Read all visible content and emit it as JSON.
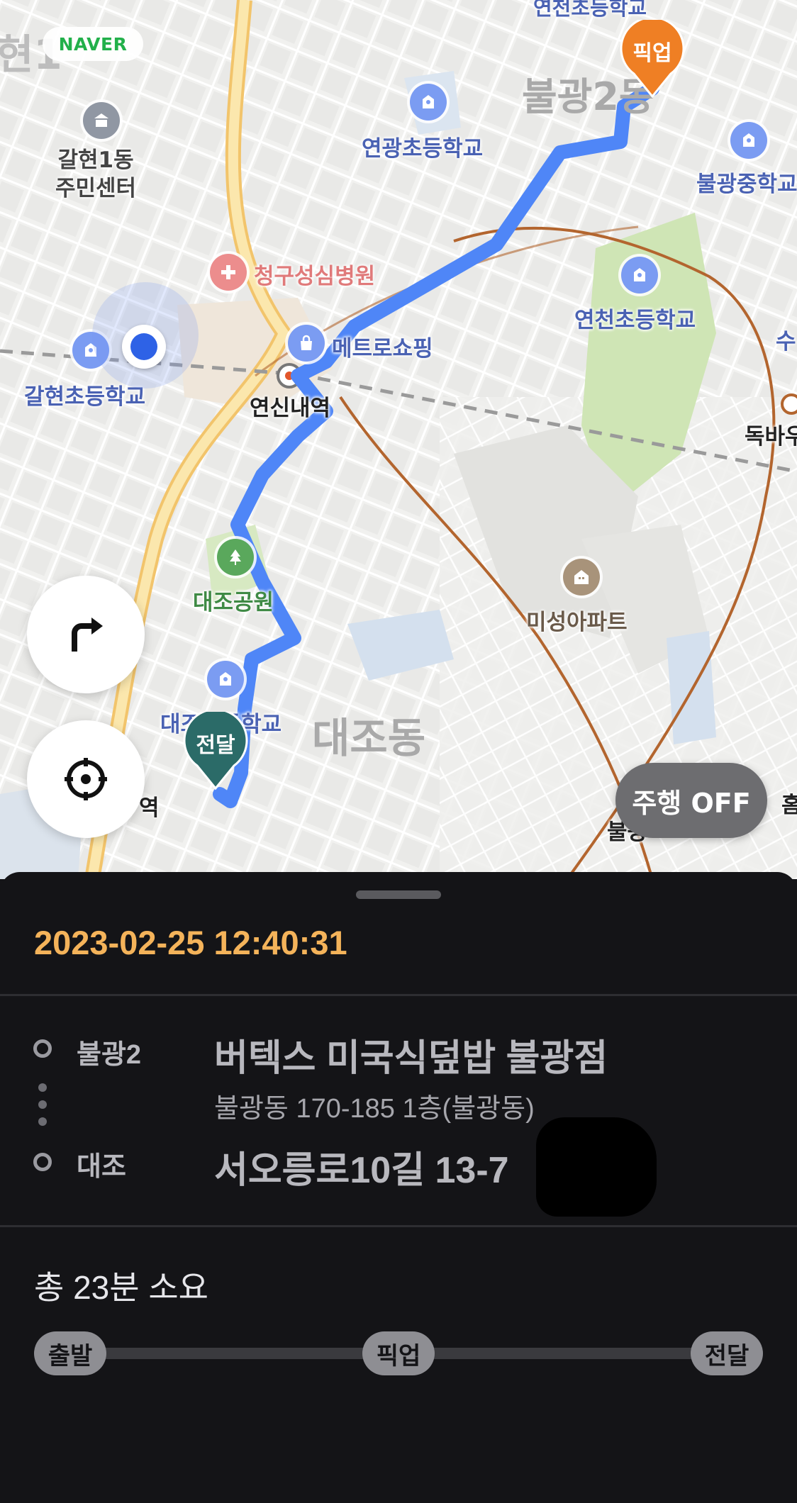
{
  "map": {
    "provider_badge": "NAVER",
    "labels": {
      "galhyeon1_center": "갈현1동\n주민센터",
      "yeongwang_school": "연광초등학교",
      "bulgwang_middle": "불광중학교",
      "cheonggu_hospital": "청구성심병원",
      "yeoncheon_school": "연천초등학교",
      "metro_shopping": "메트로쇼핑",
      "galhyeon_school": "갈현초등학교",
      "yeonsinnae_station": "연신내역",
      "dokbawi_partial": "독바우",
      "su_partial": "수",
      "daejo_park": "대조공원",
      "miseong_apt": "미성아파트",
      "daejo_school": "대조초등학교",
      "daejo_dong": "대조동",
      "bulgwang_area": "불광2동",
      "galhyeon_area_partial": "현1",
      "top_school_partial": "연천초등학교",
      "station_bottom_partial": "역",
      "bulgwang_station_partial": "불광",
      "edge_partial": "홈"
    },
    "pins": {
      "pickup": "픽업",
      "delivery": "전달"
    },
    "colors": {
      "route": "#4f86f7",
      "pickup_pin": "#ef7f24",
      "delivery_pin": "#2b6b68",
      "current_location": "#2e62e6"
    }
  },
  "controls": {
    "turn_icon": "turn-right-icon",
    "locate_icon": "crosshair-icon",
    "driving_toggle": "주행 OFF"
  },
  "sheet": {
    "datetime": "2023-02-25 12:40:31",
    "pickup": {
      "area": "불광2",
      "name": "버텍스 미국식덮밥 불광점",
      "address": "불광동 170-185 1층(불광동)"
    },
    "dropoff": {
      "area": "대조",
      "address": "서오릉로10길 13-7"
    },
    "total_time": "총 23분 소요",
    "progress_steps": [
      "출발",
      "픽업",
      "전달"
    ]
  }
}
